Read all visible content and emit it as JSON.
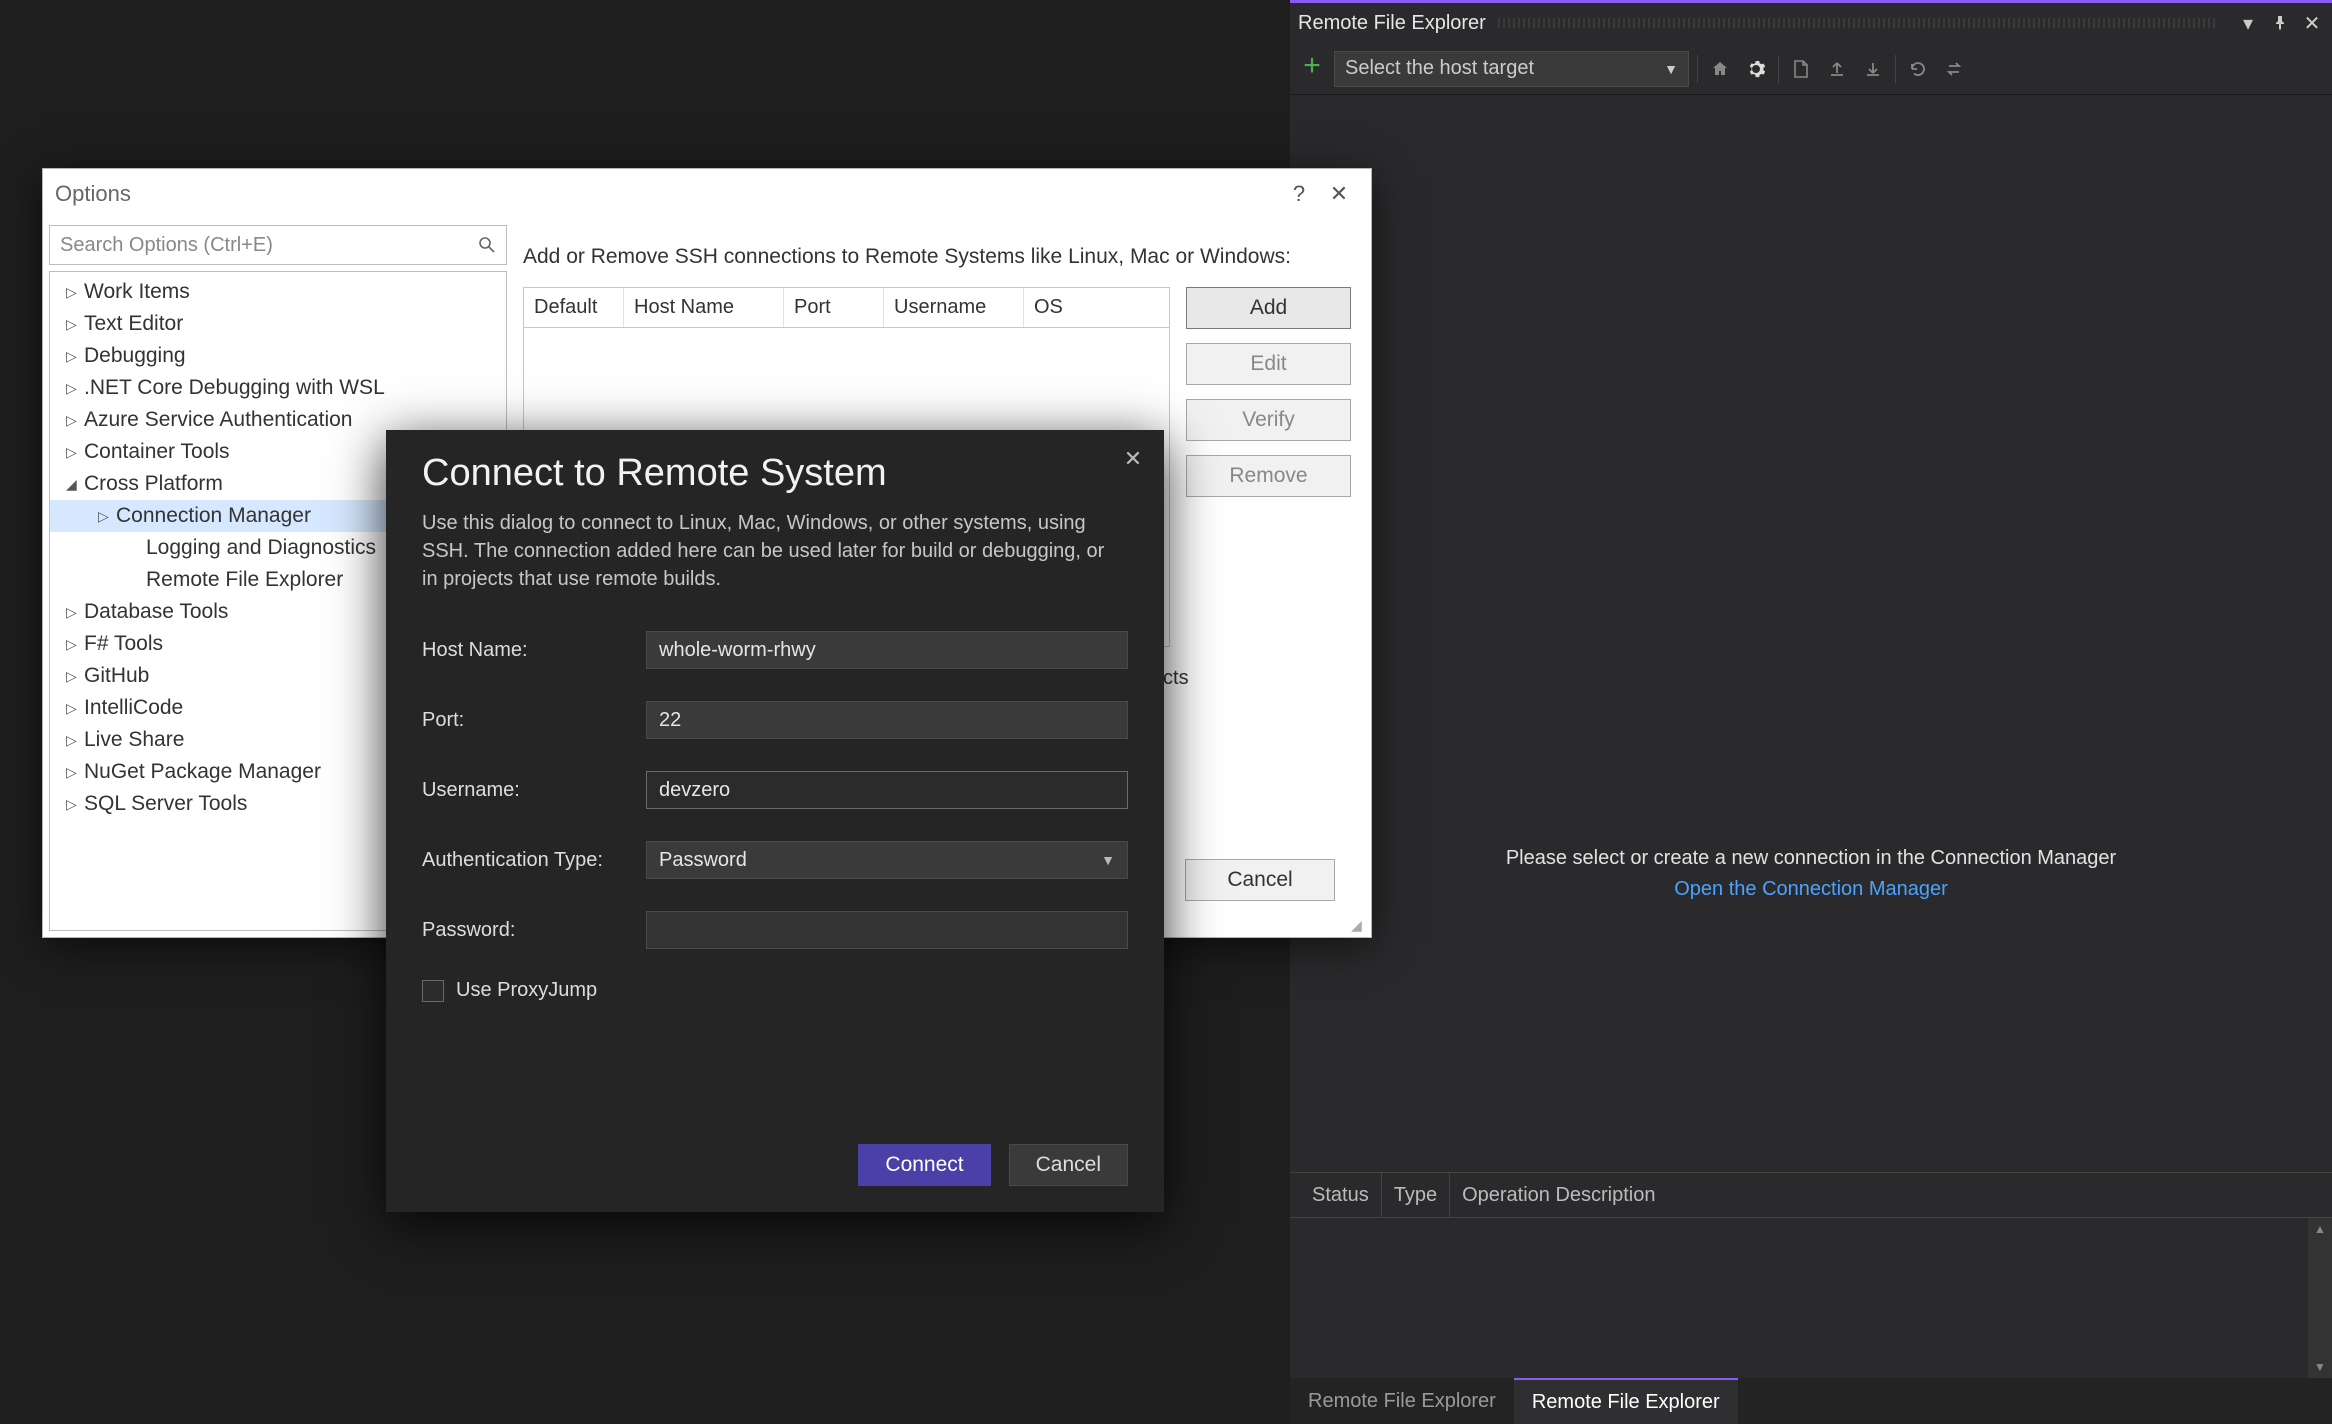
{
  "rfe": {
    "title": "Remote File Explorer",
    "host_placeholder": "Select the host target",
    "empty_msg": "Please select or create a new connection in the Connection Manager",
    "open_link": "Open the Connection Manager",
    "status_cols": [
      "Status",
      "Type",
      "Operation Description"
    ],
    "tabs": [
      "Remote File Explorer",
      "Remote File Explorer"
    ]
  },
  "options": {
    "title": "Options",
    "search_placeholder": "Search Options (Ctrl+E)",
    "tree": {
      "items": [
        {
          "label": "Work Items",
          "arrow": "▷",
          "lvl": 1
        },
        {
          "label": "Text Editor",
          "arrow": "▷",
          "lvl": 1
        },
        {
          "label": "Debugging",
          "arrow": "▷",
          "lvl": 1
        },
        {
          "label": ".NET Core Debugging with WSL",
          "arrow": "▷",
          "lvl": 1
        },
        {
          "label": "Azure Service Authentication",
          "arrow": "▷",
          "lvl": 1
        },
        {
          "label": "Container Tools",
          "arrow": "▷",
          "lvl": 1
        },
        {
          "label": "Cross Platform",
          "arrow": "◢",
          "lvl": 1
        },
        {
          "label": "Connection Manager",
          "arrow": "▷",
          "lvl": 2,
          "selected": true
        },
        {
          "label": "Logging and Diagnostics",
          "arrow": "",
          "lvl": 3
        },
        {
          "label": "Remote File Explorer",
          "arrow": "",
          "lvl": 3
        },
        {
          "label": "Database Tools",
          "arrow": "▷",
          "lvl": 1
        },
        {
          "label": "F# Tools",
          "arrow": "▷",
          "lvl": 1
        },
        {
          "label": "GitHub",
          "arrow": "▷",
          "lvl": 1
        },
        {
          "label": "IntelliCode",
          "arrow": "▷",
          "lvl": 1
        },
        {
          "label": "Live Share",
          "arrow": "▷",
          "lvl": 1
        },
        {
          "label": "NuGet Package Manager",
          "arrow": "▷",
          "lvl": 1
        },
        {
          "label": "SQL Server Tools",
          "arrow": "▷",
          "lvl": 1
        }
      ]
    },
    "right": {
      "desc": "Add or Remove SSH connections to Remote Systems like Linux, Mac or Windows:",
      "columns": [
        "Default",
        "Host Name",
        "Port",
        "Username",
        "OS"
      ],
      "buttons": {
        "add": "Add",
        "edit": "Edit",
        "verify": "Verify",
        "remove": "Remove"
      },
      "note_trail": ", or in projects",
      "cancel": "Cancel"
    }
  },
  "connect": {
    "title": "Connect to Remote System",
    "desc": "Use this dialog to connect to Linux, Mac, Windows, or other systems, using SSH. The connection added here can be used later for build or debugging, or in projects that use remote builds.",
    "labels": {
      "host": "Host Name:",
      "port": "Port:",
      "user": "Username:",
      "auth": "Authentication Type:",
      "pwd": "Password:",
      "proxy": "Use ProxyJump"
    },
    "values": {
      "host": "whole-worm-rhwy",
      "port": "22",
      "user": "devzero",
      "auth": "Password",
      "pwd": ""
    },
    "buttons": {
      "connect": "Connect",
      "cancel": "Cancel"
    }
  }
}
